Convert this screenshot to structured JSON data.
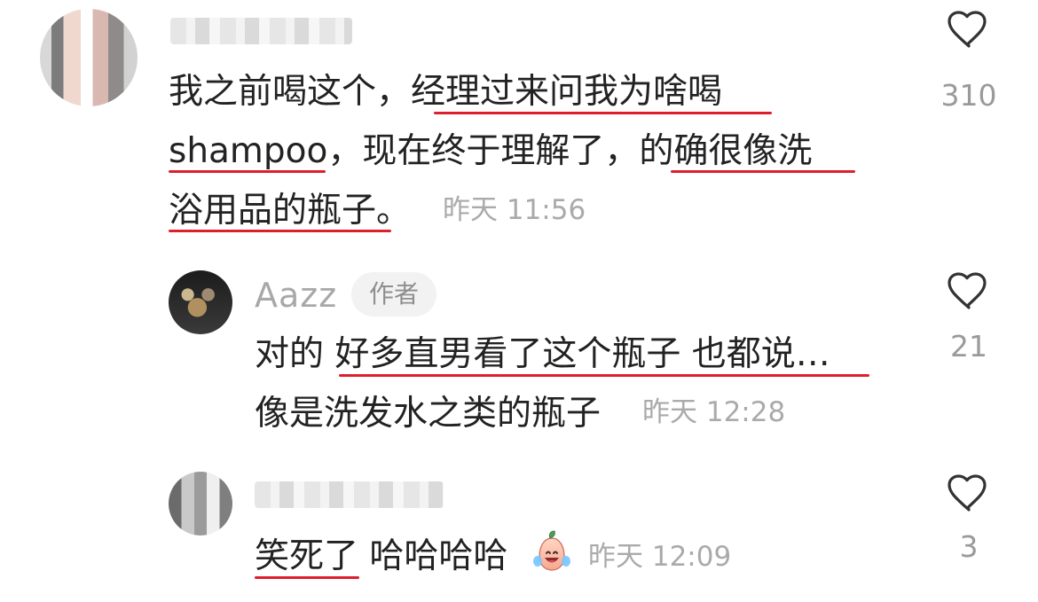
{
  "comments": [
    {
      "text_lines": [
        "我之前喝这个，经理过来问我为啥喝",
        "shampoo，现在终于理解了，的确很像洗",
        "浴用品的瓶子。"
      ],
      "timestamp": "昨天 11:56",
      "likes": "310"
    },
    {
      "author": "Aazz",
      "badge": "作者",
      "text_lines": [
        "对的 好多直男看了这个瓶子 也都说…",
        "像是洗发水之类的瓶子"
      ],
      "timestamp": "昨天 12:28",
      "likes": "21"
    },
    {
      "text_prefix": "笑死了 哈哈哈哈",
      "timestamp": "昨天 12:09",
      "likes": "3"
    }
  ],
  "icons": {
    "like": "heart-outline-icon",
    "emoji": "laughing-with-tears-emoji-icon"
  },
  "colors": {
    "underline": "#de1e2d",
    "meta": "#aaaaaa",
    "count": "#9a9a9a"
  }
}
